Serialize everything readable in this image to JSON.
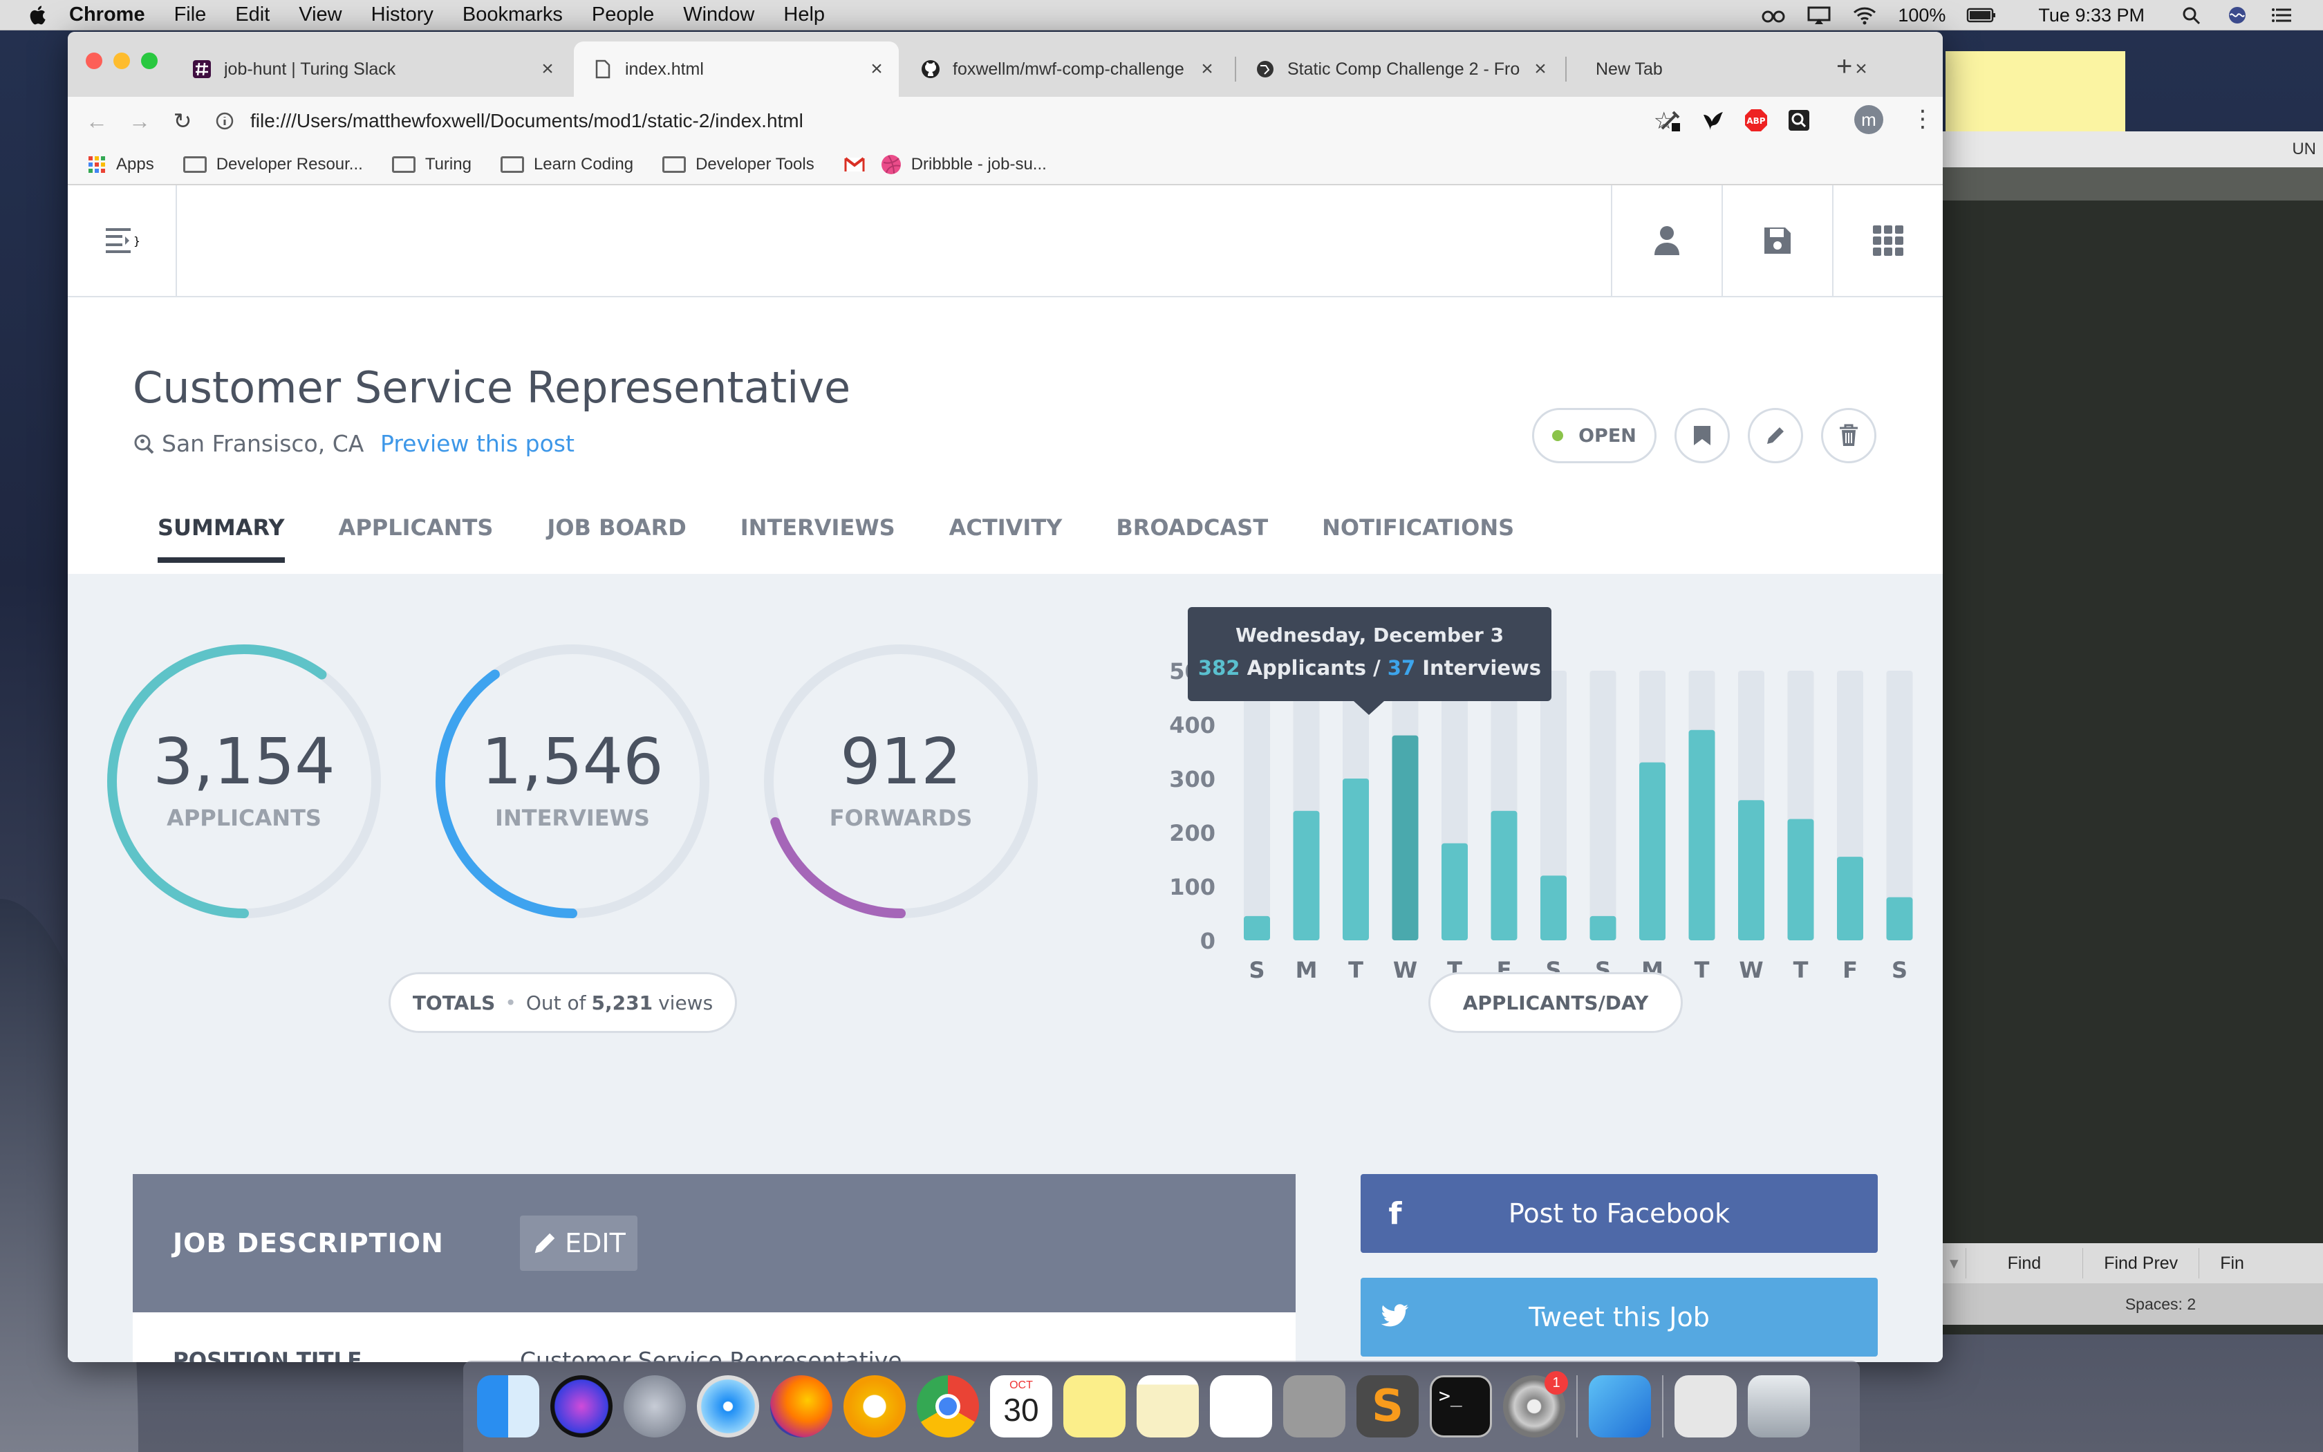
{
  "menubar": {
    "app": "Chrome",
    "items": [
      "File",
      "Edit",
      "View",
      "History",
      "Bookmarks",
      "People",
      "Window",
      "Help"
    ],
    "battery": "100%",
    "clock": "Tue 9:33 PM"
  },
  "tabs": [
    {
      "title": "job-hunt | Turing Slack"
    },
    {
      "title": "index.html"
    },
    {
      "title": "foxwellm/mwf-comp-challenge"
    },
    {
      "title": "Static Comp Challenge 2 - Fro"
    },
    {
      "title": "New Tab"
    }
  ],
  "address": {
    "url": "file:///Users/matthewfoxwell/Documents/mod1/static-2/index.html"
  },
  "profile_initial": "m",
  "bookmarks": [
    {
      "label": "Apps"
    },
    {
      "label": "Developer Resour..."
    },
    {
      "label": "Turing"
    },
    {
      "label": "Learn Coding"
    },
    {
      "label": "Developer Tools"
    },
    {
      "label": "Dribbble - job-su..."
    }
  ],
  "job": {
    "title": "Customer Service Representative",
    "location": "San Fransisco, CA",
    "preview": "Preview this post",
    "status": "OPEN"
  },
  "nav_tabs": [
    "SUMMARY",
    "APPLICANTS",
    "JOB BOARD",
    "INTERVIEWS",
    "ACTIVITY",
    "BROADCAST",
    "NOTIFICATIONS"
  ],
  "totals": {
    "applicants": {
      "value": "3,154",
      "label": "APPLICANTS",
      "fraction": 0.6
    },
    "interviews": {
      "value": "1,546",
      "label": "INTERVIEWS",
      "fraction": 0.4
    },
    "forwards": {
      "value": "912",
      "label": "FORWARDS",
      "fraction": 0.2
    },
    "pill_label": "TOTALS",
    "pill_sep": "•",
    "pill_prefix": "Out of",
    "pill_views": "5,231",
    "pill_suffix": "views"
  },
  "tooltip": {
    "date": "Wednesday, December 3",
    "applicants": "382",
    "applicants_label": "Applicants",
    "sep": "/",
    "interviews": "37",
    "interviews_label": "Interviews"
  },
  "chart_pill": "APPLICANTS/DAY",
  "chart_data": {
    "type": "bar",
    "categories": [
      "S",
      "M",
      "T",
      "W",
      "T",
      "F",
      "S",
      "S",
      "M",
      "T",
      "W",
      "T",
      "F",
      "S"
    ],
    "values": [
      45,
      240,
      300,
      380,
      180,
      240,
      120,
      45,
      330,
      390,
      260,
      225,
      155,
      80
    ],
    "ylim": [
      0,
      500
    ],
    "yticks": [
      "0",
      "100",
      "200",
      "300",
      "400",
      "500"
    ],
    "highlight_index": 3,
    "colors": {
      "bar": "#5ec3c8",
      "highlight": "#4aa9ad",
      "track": "#dfe5ec"
    }
  },
  "description": {
    "header": "JOB DESCRIPTION",
    "edit": "EDIT",
    "position_label": "POSITION TITLE",
    "position_value": "Customer Service Representative"
  },
  "share": {
    "facebook": "Post to Facebook",
    "twitter": "Tweet this Job"
  },
  "editor": {
    "find": "Find",
    "find_prev": "Find Prev",
    "find_next": "Fin",
    "status": "Spaces: 2",
    "corner": "UN"
  },
  "dock": {
    "calendar_month": "OCT",
    "calendar_day": "30",
    "badge": "1"
  },
  "colors": {
    "teal": "#5ec3c8",
    "blue": "#3ea3ef",
    "purple": "#a566b8",
    "facebook": "#4e69a8",
    "twitter": "#55a8e1",
    "header_gray": "#747d92"
  }
}
